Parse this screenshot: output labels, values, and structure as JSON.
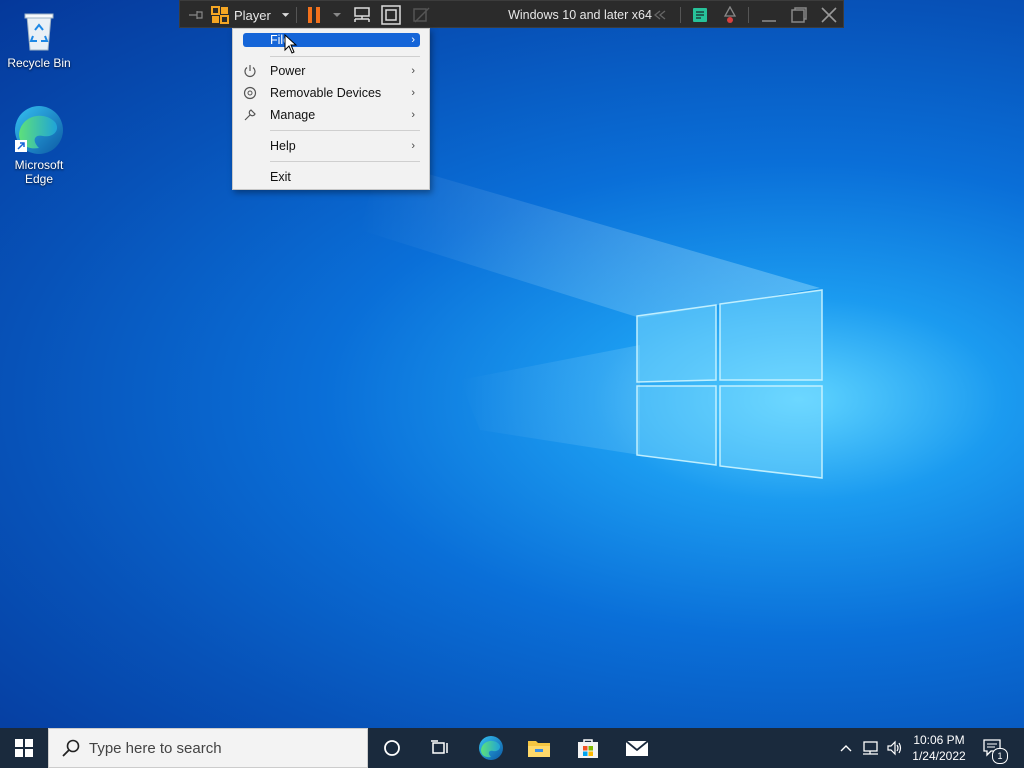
{
  "desktop": {
    "icons": [
      {
        "label": "Recycle Bin",
        "icon": "recycle-bin-icon"
      },
      {
        "label": "Microsoft\nEdge",
        "label_line1": "Microsoft",
        "label_line2": "Edge",
        "icon": "edge-icon"
      }
    ]
  },
  "player_bar": {
    "menu_label": "Player",
    "vm_title": "Windows 10 and later x64",
    "colors": {
      "pause": "#f2711c",
      "background": "#2b2b2b"
    }
  },
  "player_menu": {
    "items": [
      {
        "label": "File",
        "has_submenu": true,
        "highlighted": true
      },
      {
        "label": "Power",
        "has_submenu": true,
        "icon": "power-icon"
      },
      {
        "label": "Removable Devices",
        "has_submenu": true,
        "icon": "removable-devices-icon"
      },
      {
        "label": "Manage",
        "has_submenu": true,
        "icon": "wrench-icon"
      },
      {
        "label": "Help",
        "has_submenu": true
      },
      {
        "label": "Exit",
        "has_submenu": false
      }
    ],
    "submenu_arrow": "›"
  },
  "taskbar": {
    "search_placeholder": "Type here to search",
    "time": "10:06 PM",
    "date": "1/24/2022",
    "notification_count": "1",
    "accent": "#1565d8"
  }
}
